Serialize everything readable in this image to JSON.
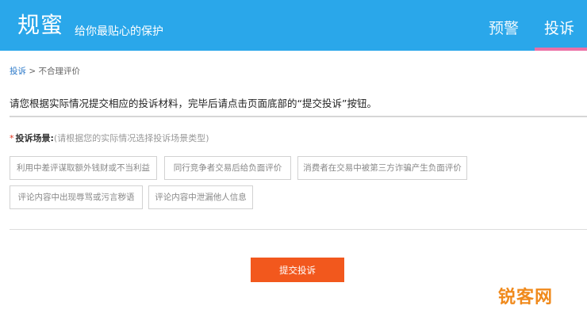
{
  "header": {
    "logo": "规蜜",
    "slogan": "给你最贴心的保护",
    "nav": [
      {
        "label": "预警"
      },
      {
        "label": "投诉",
        "active": true
      }
    ]
  },
  "breadcrumb": {
    "link": "投诉",
    "separator": ">",
    "current": "不合理评价"
  },
  "instruction": "请您根据实际情况提交相应的投诉材料，完毕后请点击页面底部的“提交投诉”按钮。",
  "scenario": {
    "required_mark": "*",
    "title": "投诉场景:",
    "hint": "(请根据您的实际情况选择投诉场景类型)",
    "options": [
      "利用中差评谋取额外钱财或不当利益",
      "同行竞争者交易后给负面评价",
      "消费者在交易中被第三方诈骗产生负面评价",
      "评论内容中出现辱骂或污言秽语",
      "评论内容中泄漏他人信息"
    ]
  },
  "submit_label": "提交投诉",
  "watermark": "锐客网",
  "colors": {
    "header_bg": "#2aa7ea",
    "nav_active_underline": "#ec6fa6",
    "submit_bg": "#f2581d",
    "required_mark": "#e0331c",
    "link": "#2a78c8"
  }
}
